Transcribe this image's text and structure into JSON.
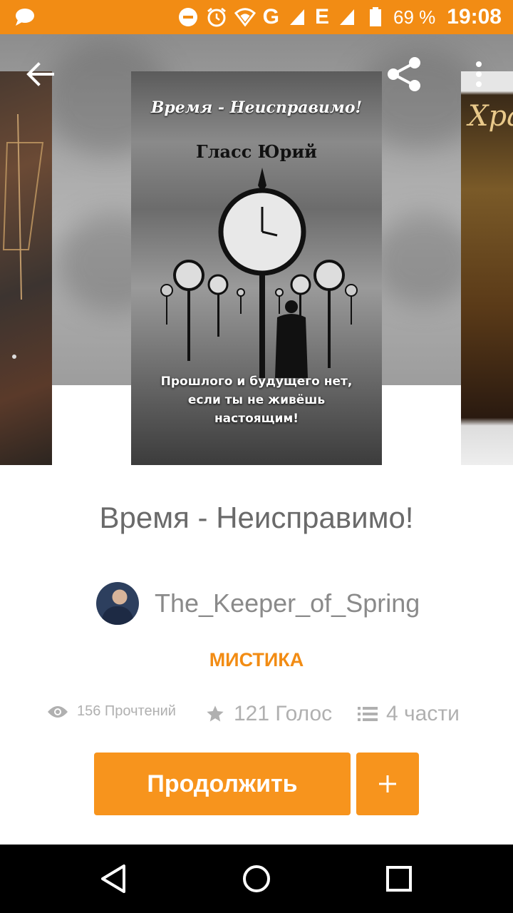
{
  "status_bar": {
    "battery_percent": "69 %",
    "time": "19:08",
    "network_1": "G",
    "network_2": "E",
    "icons": [
      "chat-icon",
      "do-not-disturb-icon",
      "alarm-icon",
      "wifi-icon",
      "signal-icon",
      "battery-icon"
    ]
  },
  "header": {
    "icons": [
      "back-arrow-icon",
      "share-icon",
      "more-vert-icon"
    ]
  },
  "cover": {
    "title": "Время - Неисправимо!",
    "author": "Гласс Юрий",
    "slogan_line1": "Прошлого и будущего нет,",
    "slogan_line2": "если ты не живёшь",
    "slogan_line3": "настоящим!",
    "right_cover_title": "Хра"
  },
  "book": {
    "title": "Время - Неисправимо!",
    "author_name": "The_Keeper_of_Spring",
    "genre": "МИСТИКА"
  },
  "stats": {
    "reads": "156 Прочтений",
    "votes": "121 Голос",
    "parts": "4 части"
  },
  "actions": {
    "continue_label": "Продолжить",
    "add_icon": "plus-icon"
  },
  "nav_bar": {
    "icons": [
      "back-triangle-icon",
      "home-circle-icon",
      "recents-square-icon"
    ]
  },
  "colors": {
    "accent": "#f7941d",
    "status_bar": "#f28c14",
    "text_gray": "#6a6a6a",
    "stat_gray": "#b0b0b0"
  }
}
